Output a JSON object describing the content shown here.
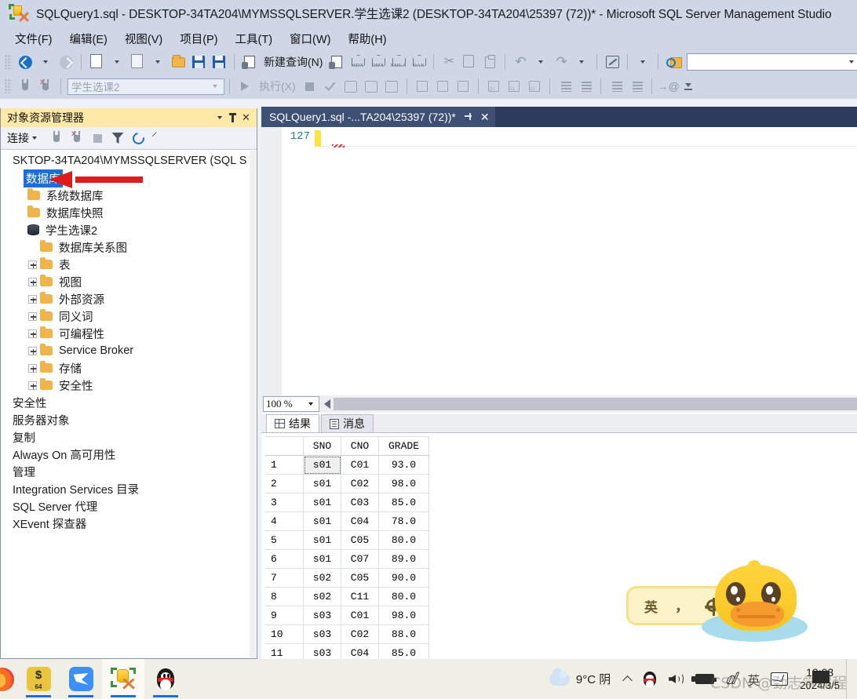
{
  "window": {
    "title": "SQLQuery1.sql - DESKTOP-34TA204\\MYMSSQLSERVER.学生选课2 (DESKTOP-34TA204\\25397 (72))* - Microsoft SQL Server Management Studio",
    "icon": "ssms-icon"
  },
  "menubar": {
    "items": [
      {
        "label": "文件(F)",
        "name": "menu-file"
      },
      {
        "label": "编辑(E)",
        "name": "menu-edit"
      },
      {
        "label": "视图(V)",
        "name": "menu-view"
      },
      {
        "label": "项目(P)",
        "name": "menu-project"
      },
      {
        "label": "工具(T)",
        "name": "menu-tools"
      },
      {
        "label": "窗口(W)",
        "name": "menu-window"
      },
      {
        "label": "帮助(H)",
        "name": "menu-help"
      }
    ]
  },
  "toolbar_row1": {
    "new_query_label": "新建查询(N)",
    "cube_labels": {
      "mdx": "MDX",
      "dmx": "DMX",
      "xmla": "XMLA",
      "dax": "DAX"
    },
    "find_combo_value": ""
  },
  "toolbar_row2": {
    "database_combo_value": "学生选课2",
    "execute_label": "执行(X)"
  },
  "object_explorer": {
    "title": "对象资源管理器",
    "connect_label": "连接",
    "tree": [
      {
        "label": "SKTOP-34TA204\\MYMSSQLSERVER (SQL S",
        "indent": 0,
        "icon": "none",
        "expander": "none",
        "selected": false
      },
      {
        "label": "数据库",
        "indent": 1,
        "icon": "none",
        "expander": "none",
        "selected": true
      },
      {
        "label": "系统数据库",
        "indent": 1,
        "icon": "folder",
        "expander": "none",
        "selected": false
      },
      {
        "label": "数据库快照",
        "indent": 1,
        "icon": "folder",
        "expander": "none",
        "selected": false
      },
      {
        "label": "学生选课2",
        "indent": 1,
        "icon": "database",
        "expander": "none",
        "selected": false
      },
      {
        "label": "数据库关系图",
        "indent": 2,
        "icon": "folder",
        "expander": "none",
        "selected": false
      },
      {
        "label": "表",
        "indent": 2,
        "icon": "folder",
        "expander": "plus",
        "selected": false
      },
      {
        "label": "视图",
        "indent": 2,
        "icon": "folder",
        "expander": "plus",
        "selected": false
      },
      {
        "label": "外部资源",
        "indent": 2,
        "icon": "folder",
        "expander": "plus",
        "selected": false
      },
      {
        "label": "同义词",
        "indent": 2,
        "icon": "folder",
        "expander": "plus",
        "selected": false
      },
      {
        "label": "可编程性",
        "indent": 2,
        "icon": "folder",
        "expander": "plus",
        "selected": false
      },
      {
        "label": "Service Broker",
        "indent": 2,
        "icon": "folder",
        "expander": "plus",
        "selected": false
      },
      {
        "label": "存储",
        "indent": 2,
        "icon": "folder",
        "expander": "plus",
        "selected": false
      },
      {
        "label": "安全性",
        "indent": 2,
        "icon": "folder",
        "expander": "plus",
        "selected": false
      },
      {
        "label": "安全性",
        "indent": 0,
        "icon": "none",
        "expander": "none",
        "selected": false
      },
      {
        "label": "服务器对象",
        "indent": 0,
        "icon": "none",
        "expander": "none",
        "selected": false
      },
      {
        "label": "复制",
        "indent": 0,
        "icon": "none",
        "expander": "none",
        "selected": false
      },
      {
        "label": "Always On 高可用性",
        "indent": 0,
        "icon": "none",
        "expander": "none",
        "selected": false
      },
      {
        "label": "管理",
        "indent": 0,
        "icon": "none",
        "expander": "none",
        "selected": false
      },
      {
        "label": "Integration Services 目录",
        "indent": 0,
        "icon": "none",
        "expander": "none",
        "selected": false
      },
      {
        "label": "SQL Server 代理",
        "indent": 0,
        "icon": "none",
        "expander": "none",
        "selected": false
      },
      {
        "label": "XEvent 探查器",
        "indent": 0,
        "icon": "none",
        "expander": "none",
        "selected": false
      }
    ]
  },
  "annotation": {
    "arrow_color": "#e01b1b",
    "points_to": "数据库"
  },
  "editor": {
    "tab_title": "SQLQuery1.sql -...TA204\\25397 (72))*",
    "line_number": "127",
    "code_text": "",
    "zoom_level": "100 %"
  },
  "results": {
    "tabs": [
      {
        "label": "结果",
        "icon": "grid-icon",
        "active": true
      },
      {
        "label": "消息",
        "icon": "message-icon",
        "active": false
      }
    ],
    "columns": [
      "",
      "SNO",
      "CNO",
      "GRADE"
    ],
    "rows": [
      {
        "n": "1",
        "SNO": "s01",
        "CNO": "C01",
        "GRADE": "93.0"
      },
      {
        "n": "2",
        "SNO": "s01",
        "CNO": "C02",
        "GRADE": "98.0"
      },
      {
        "n": "3",
        "SNO": "s01",
        "CNO": "C03",
        "GRADE": "85.0"
      },
      {
        "n": "4",
        "SNO": "s01",
        "CNO": "C04",
        "GRADE": "78.0"
      },
      {
        "n": "5",
        "SNO": "s01",
        "CNO": "C05",
        "GRADE": "80.0"
      },
      {
        "n": "6",
        "SNO": "s01",
        "CNO": "C07",
        "GRADE": "89.0"
      },
      {
        "n": "7",
        "SNO": "s02",
        "CNO": "C05",
        "GRADE": "90.0"
      },
      {
        "n": "8",
        "SNO": "s02",
        "CNO": "C11",
        "GRADE": "80.0"
      },
      {
        "n": "9",
        "SNO": "s03",
        "CNO": "C01",
        "GRADE": "98.0"
      },
      {
        "n": "10",
        "SNO": "s03",
        "CNO": "C02",
        "GRADE": "88.0"
      },
      {
        "n": "11",
        "SNO": "s03",
        "CNO": "C04",
        "GRADE": "85.0"
      }
    ],
    "focused_cell": "s01"
  },
  "ime_bar": {
    "mode_label": "英",
    "punct_label": "，",
    "settings_icon": "gear-icon",
    "mascot": "duck-icon"
  },
  "taskbar": {
    "apps": [
      {
        "name": "taskbar-firefox",
        "icon": "firefox-icon",
        "running": false,
        "active": false
      },
      {
        "name": "taskbar-pdf",
        "icon": "pdf-icon",
        "badge": "64",
        "glyph": "$",
        "running": true,
        "active": false
      },
      {
        "name": "taskbar-foxmail",
        "icon": "blue-bird-icon",
        "running": true,
        "active": false
      },
      {
        "name": "taskbar-ssms",
        "icon": "ssms-icon",
        "running": true,
        "active": true
      },
      {
        "name": "taskbar-qq",
        "icon": "qq-penguin-icon",
        "running": true,
        "active": false
      }
    ],
    "tray": {
      "weather": "9°C 阴",
      "weather_icon": "cloud-icon",
      "chevron": "chevron-up-icon",
      "icons": [
        "qq-icon",
        "volume-icon",
        "battery-icon",
        "pen-icon",
        "mail-icon"
      ],
      "ime_lang": "英",
      "time": "19:03",
      "date": "2024/3/5"
    }
  },
  "watermark": {
    "text": "CSDN @劲志学编程"
  }
}
